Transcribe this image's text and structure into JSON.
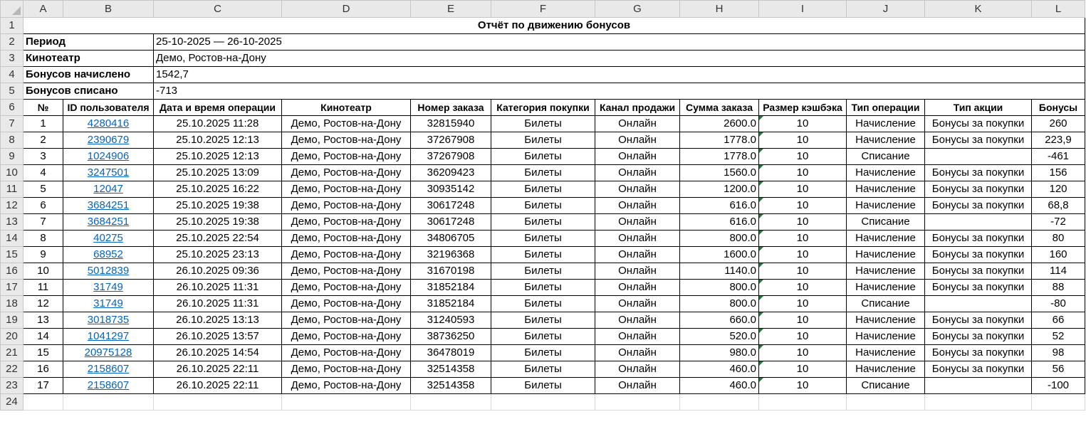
{
  "columns": [
    "A",
    "B",
    "C",
    "D",
    "E",
    "F",
    "G",
    "H",
    "I",
    "J",
    "K",
    "L"
  ],
  "report": {
    "title": "Отчёт по движению бонусов",
    "period_label": "Период",
    "period_value": "25-10-2025 — 26-10-2025",
    "cinema_label": "Кинотеатр",
    "cinema_value": "Демо, Ростов-на-Дону",
    "accrued_label": "Бонусов начислено",
    "accrued_value": "1542,7",
    "spent_label": "Бонусов списано",
    "spent_value": "-713"
  },
  "table": {
    "headers": [
      "№",
      "ID пользователя",
      "Дата и время операции",
      "Кинотеатр",
      "Номер заказа",
      "Категория покупки",
      "Канал продажи",
      "Сумма заказа",
      "Размер кэшбэка",
      "Тип операции",
      "Тип акции",
      "Бонусы"
    ],
    "rows": [
      [
        "1",
        "4280416",
        "25.10.2025 11:28",
        "Демо, Ростов-на-Дону",
        "32815940",
        "Билеты",
        "Онлайн",
        "2600.0",
        "10",
        "Начисление",
        "Бонусы за покупки",
        "260"
      ],
      [
        "2",
        "2390679",
        "25.10.2025 12:13",
        "Демо, Ростов-на-Дону",
        "37267908",
        "Билеты",
        "Онлайн",
        "1778.0",
        "10",
        "Начисление",
        "Бонусы за покупки",
        "223,9"
      ],
      [
        "3",
        "1024906",
        "25.10.2025 12:13",
        "Демо, Ростов-на-Дону",
        "37267908",
        "Билеты",
        "Онлайн",
        "1778.0",
        "10",
        "Списание",
        "",
        "-461"
      ],
      [
        "4",
        "3247501",
        "25.10.2025 13:09",
        "Демо, Ростов-на-Дону",
        "36209423",
        "Билеты",
        "Онлайн",
        "1560.0",
        "10",
        "Начисление",
        "Бонусы за покупки",
        "156"
      ],
      [
        "5",
        "12047",
        "25.10.2025 16:22",
        "Демо, Ростов-на-Дону",
        "30935142",
        "Билеты",
        "Онлайн",
        "1200.0",
        "10",
        "Начисление",
        "Бонусы за покупки",
        "120"
      ],
      [
        "6",
        "3684251",
        "25.10.2025 19:38",
        "Демо, Ростов-на-Дону",
        "30617248",
        "Билеты",
        "Онлайн",
        "616.0",
        "10",
        "Начисление",
        "Бонусы за покупки",
        "68,8"
      ],
      [
        "7",
        "3684251",
        "25.10.2025 19:38",
        "Демо, Ростов-на-Дону",
        "30617248",
        "Билеты",
        "Онлайн",
        "616.0",
        "10",
        "Списание",
        "",
        "-72"
      ],
      [
        "8",
        "40275",
        "25.10.2025 22:54",
        "Демо, Ростов-на-Дону",
        "34806705",
        "Билеты",
        "Онлайн",
        "800.0",
        "10",
        "Начисление",
        "Бонусы за покупки",
        "80"
      ],
      [
        "9",
        "68952",
        "25.10.2025 23:13",
        "Демо, Ростов-на-Дону",
        "32196368",
        "Билеты",
        "Онлайн",
        "1600.0",
        "10",
        "Начисление",
        "Бонусы за покупки",
        "160"
      ],
      [
        "10",
        "5012839",
        "26.10.2025 09:36",
        "Демо, Ростов-на-Дону",
        "31670198",
        "Билеты",
        "Онлайн",
        "1140.0",
        "10",
        "Начисление",
        "Бонусы за покупки",
        "114"
      ],
      [
        "11",
        "31749",
        "26.10.2025 11:31",
        "Демо, Ростов-на-Дону",
        "31852184",
        "Билеты",
        "Онлайн",
        "800.0",
        "10",
        "Начисление",
        "Бонусы за покупки",
        "88"
      ],
      [
        "12",
        "31749",
        "26.10.2025 11:31",
        "Демо, Ростов-на-Дону",
        "31852184",
        "Билеты",
        "Онлайн",
        "800.0",
        "10",
        "Списание",
        "",
        "-80"
      ],
      [
        "13",
        "3018735",
        "26.10.2025 13:13",
        "Демо, Ростов-на-Дону",
        "31240593",
        "Билеты",
        "Онлайн",
        "660.0",
        "10",
        "Начисление",
        "Бонусы за покупки",
        "66"
      ],
      [
        "14",
        "1041297",
        "26.10.2025 13:57",
        "Демо, Ростов-на-Дону",
        "38736250",
        "Билеты",
        "Онлайн",
        "520.0",
        "10",
        "Начисление",
        "Бонусы за покупки",
        "52"
      ],
      [
        "15",
        "20975128",
        "26.10.2025 14:54",
        "Демо, Ростов-на-Дону",
        "36478019",
        "Билеты",
        "Онлайн",
        "980.0",
        "10",
        "Начисление",
        "Бонусы за покупки",
        "98"
      ],
      [
        "16",
        "2158607",
        "26.10.2025 22:11",
        "Демо, Ростов-на-Дону",
        "32514358",
        "Билеты",
        "Онлайн",
        "460.0",
        "10",
        "Начисление",
        "Бонусы за покупки",
        "56"
      ],
      [
        "17",
        "2158607",
        "26.10.2025 22:11",
        "Демо, Ростов-на-Дону",
        "32514358",
        "Билеты",
        "Онлайн",
        "460.0",
        "10",
        "Списание",
        "",
        "-100"
      ]
    ]
  },
  "colors": {
    "link": "#0563c1",
    "header_bg": "#e9e9e9",
    "grid": "#d9d9d9",
    "error_tag": "#1f7a3a"
  }
}
